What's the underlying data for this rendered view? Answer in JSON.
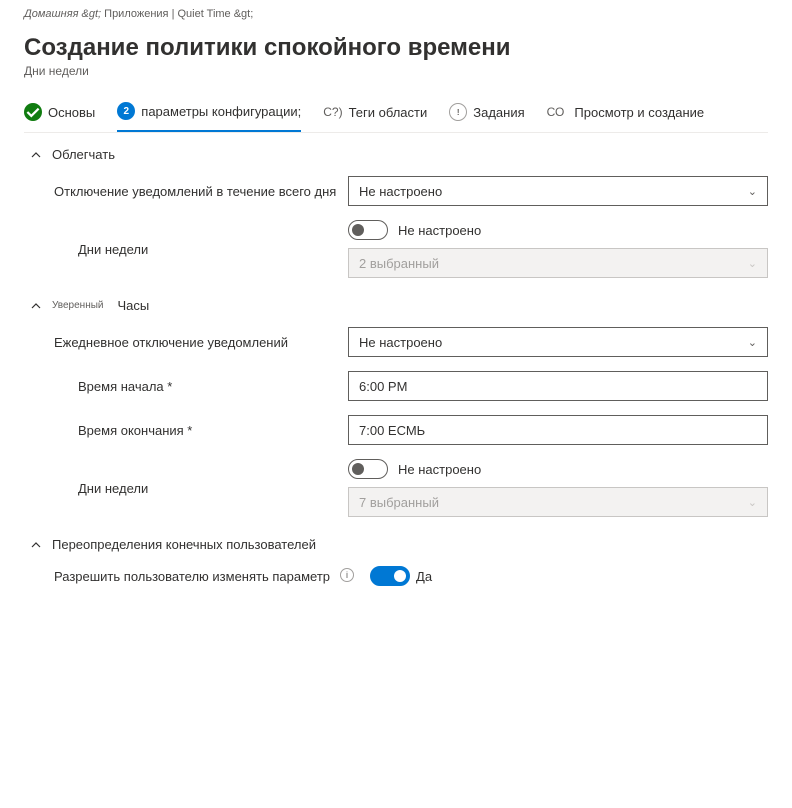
{
  "breadcrumb": {
    "home": "Домашняя &gt;",
    "path": "Приложения | Quiet Time &gt;"
  },
  "page": {
    "title": "Создание политики спокойного времени",
    "subtitle": "Дни недели"
  },
  "wizard": {
    "step1": "Основы",
    "step2_num": "2",
    "step2": "параметры конфигурации;",
    "step3_marker": "С?)",
    "step3": "Теги области",
    "step4_marker": "(!)",
    "step4": "Задания",
    "step5_marker": "СО",
    "step5": "Просмотр и создание"
  },
  "sections": {
    "relieve": {
      "title": "Облегчать",
      "allday_label": "Отключение уведомлений в течение всего дня",
      "allday_value": "Не настроено",
      "days_label": "Дни недели",
      "days_toggle_state": "Не настроено",
      "days_selected": "2 выбранный"
    },
    "hours": {
      "small": "Уверенный",
      "title": "Часы",
      "daily_label": "Ежедневное отключение уведомлений",
      "daily_value": "Не настроено",
      "start_label": "Время начала *",
      "start_value": "6:00 PM",
      "end_label": "Время окончания *",
      "end_value": "7:00 ЕСМЬ",
      "days_label": "Дни недели",
      "days_toggle_state": "Не настроено",
      "days_selected": "7 выбранный"
    },
    "overrides": {
      "title": "Переопределения конечных пользователей",
      "allow_label": "Разрешить пользователю изменять параметр",
      "allow_value": "Да"
    }
  }
}
